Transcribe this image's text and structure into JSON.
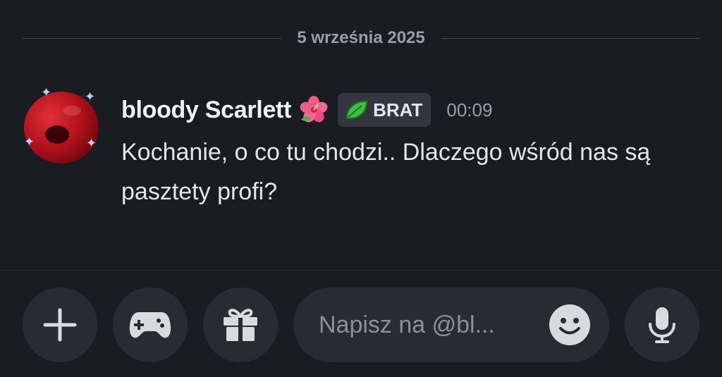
{
  "divider": {
    "date": "5 września 2025"
  },
  "message": {
    "username": "bloody Scarlett",
    "username_emoji": "hibiscus-icon",
    "tag": {
      "icon": "leaf-icon",
      "label": "BRAT"
    },
    "timestamp": "00:09",
    "text": "Kochanie, o co tu chodzi.. Dlaczego wśród nas są pasztety profi?"
  },
  "composer": {
    "placeholder": "Napisz na @bl...",
    "buttons": [
      "plus-icon",
      "gamepad-icon",
      "gift-icon",
      "emoji-icon",
      "microphone-icon"
    ]
  },
  "colors": {
    "background": "#1b1c21",
    "button_bg": "#2a2b32",
    "badge_bg": "#34363e",
    "muted_text": "#9a9ca5",
    "leaf_green": "#3fbf4a"
  }
}
